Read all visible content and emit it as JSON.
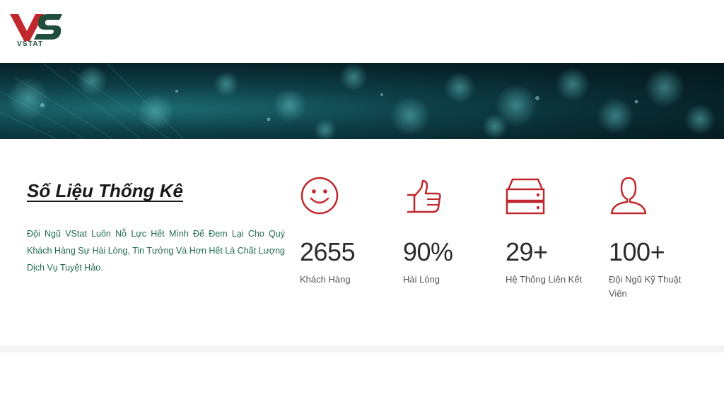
{
  "brand": {
    "name": "VSTAT",
    "primary": "#c0282d",
    "secondary": "#1f4e3a"
  },
  "section": {
    "title": "Số Liệu Thống Kê",
    "description": "Đội Ngũ VStat Luôn Nỗ Lực Hết Mình Để Đem Lại Cho Quý Khách Hàng Sự Hài Lòng, Tin Tưởng Và Hơn Hết Là Chất Lượng Dịch Vụ Tuyệt Hảo."
  },
  "stats": [
    {
      "icon": "smiley-icon",
      "value": "2655",
      "label": "Khách Hàng"
    },
    {
      "icon": "thumbs-up-icon",
      "value": "90%",
      "label": "Hài Lòng"
    },
    {
      "icon": "server-icon",
      "value": "29+",
      "label": "Hệ Thống Liên Kết"
    },
    {
      "icon": "user-icon",
      "value": "100+",
      "label": "Đội Ngũ Kỹ Thuật Viên"
    }
  ]
}
